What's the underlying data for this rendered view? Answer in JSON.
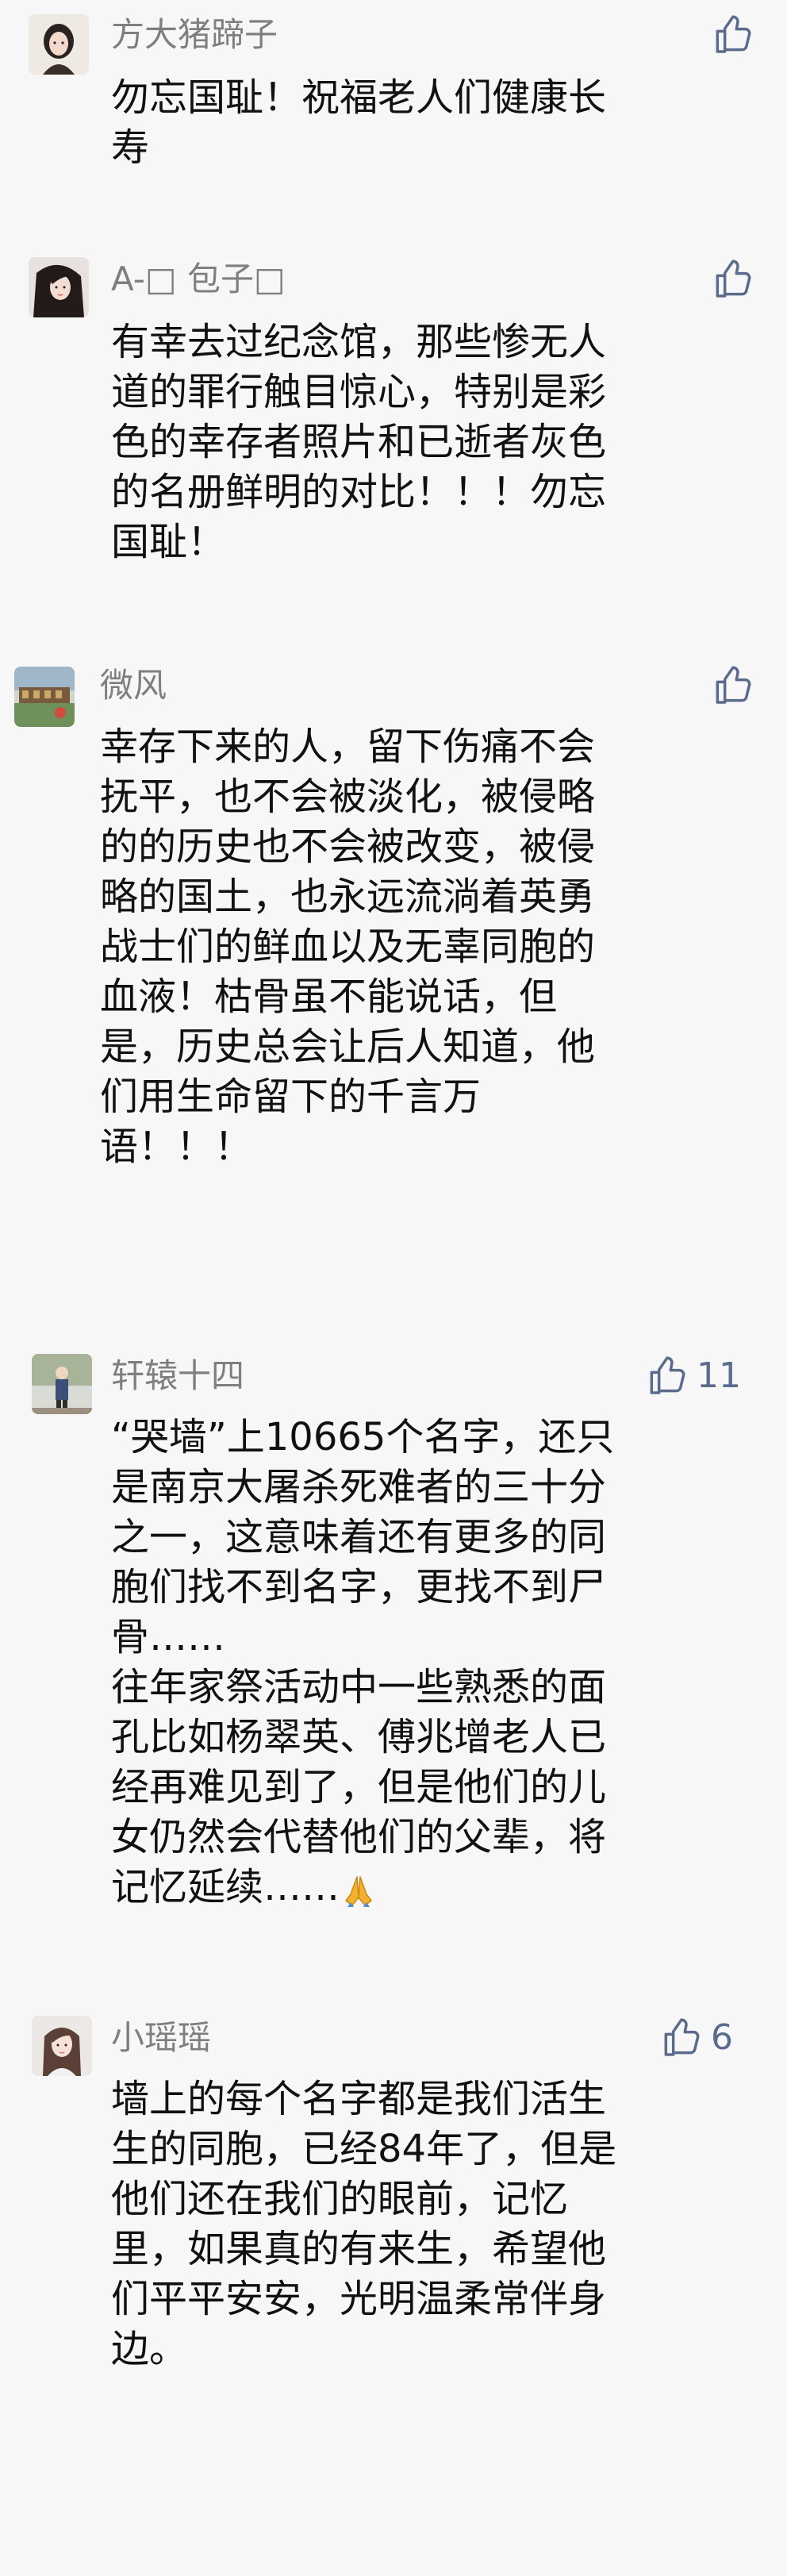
{
  "comments": [
    {
      "username": "方大猪蹄子",
      "like_icon": "thumbs-up-outline-icon",
      "like_count": "",
      "lines": [
        "勿忘国耻！祝福老人们健康长",
        "寿"
      ]
    },
    {
      "username": "A-□ 包子□",
      "like_icon": "thumbs-up-outline-icon",
      "like_count": "",
      "lines": [
        "有幸去过纪念馆，那些惨无人",
        "道的罪行触目惊心，特别是彩",
        "色的幸存者照片和已逝者灰色",
        "的名册鲜明的对比！！！勿忘",
        "国耻！"
      ]
    },
    {
      "username": "微风",
      "like_icon": "thumbs-up-outline-icon",
      "like_count": "",
      "lines": [
        "幸存下来的人，留下伤痛不会",
        "抚平，也不会被淡化，被侵略",
        "的的历史也不会被改变，被侵",
        "略的国土，也永远流淌着英勇",
        "战士们的鲜血以及无辜同胞的",
        "血液！枯骨虽不能说话，但",
        "是，历史总会让后人知道，他",
        "们用生命留下的千言万",
        "语！！！"
      ]
    },
    {
      "username": "轩辕十四",
      "like_icon": "thumbs-up-outline-icon",
      "like_count": "11",
      "lines": [
        "“哭墙”上10665个名字，还只",
        "是南京大屠杀死难者的三十分",
        "之一，这意味着还有更多的同",
        "胞们找不到名字，更找不到尸",
        "骨……",
        "往年家祭活动中一些熟悉的面",
        "孔比如杨翠英、傅兆增老人已",
        "经再难见到了，但是他们的儿",
        "女仍然会代替他们的父辈，将",
        "记忆延续……"
      ],
      "emoji": "folded-hands-icon"
    },
    {
      "username": "小瑶瑶",
      "like_icon": "thumbs-up-outline-icon",
      "like_count": "6",
      "lines": [
        "墙上的每个名字都是我们活生",
        "生的同胞，已经84年了，但是",
        "他们还在我们的眼前，记忆",
        "里，如果真的有来生，希望他",
        "们平平安安，光明温柔常伴身",
        "边。"
      ]
    }
  ],
  "colors": {
    "background": "#f7f7f7",
    "username": "#7f7f7f",
    "body_text": "#111111",
    "like_icon": "#5b6b8c"
  }
}
